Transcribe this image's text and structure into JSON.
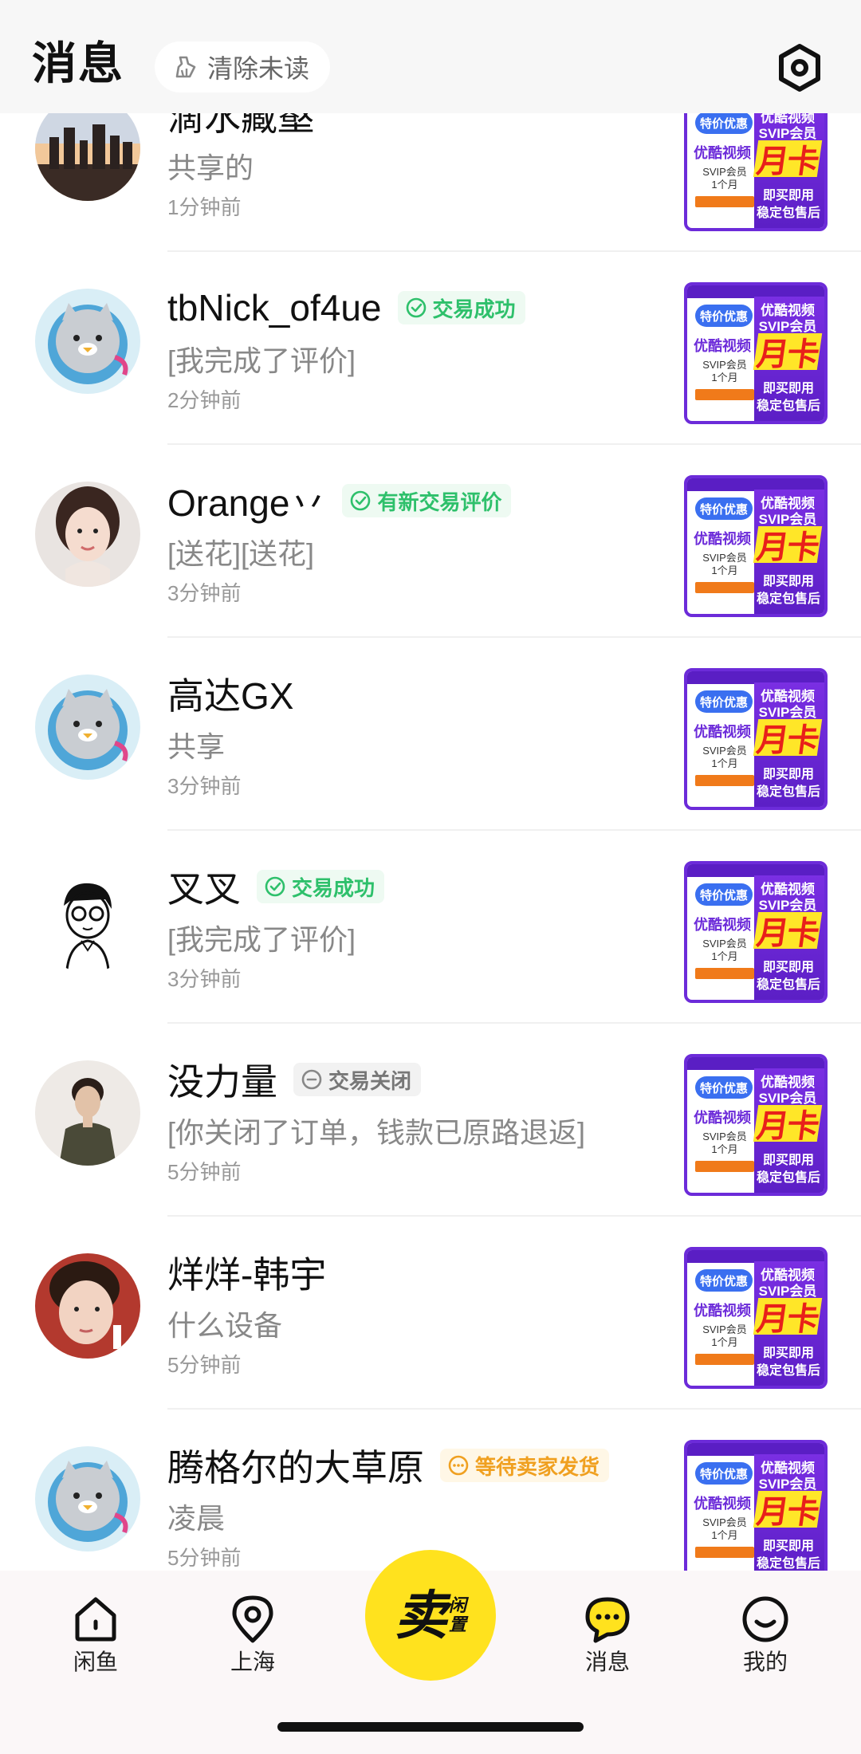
{
  "header": {
    "title": "消息",
    "clear_unread_label": "清除未读",
    "clear_icon": "broom-icon",
    "settings_icon": "settings-icon"
  },
  "thumbnail": {
    "pill": "特价优惠",
    "right_line1": "优酷视频",
    "right_line2": "SVIP会员",
    "left_brand": "优酷视频",
    "card": "月卡",
    "svip": "SVIP会员",
    "duration": "1个月",
    "buy": "即买即用",
    "stable": "稳定包售后"
  },
  "messages": [
    {
      "name": "滴水藏壑",
      "badge": "",
      "badge_type": "",
      "preview": "共享的",
      "time": "1分钟前",
      "avatar": "city-skyline-avatar"
    },
    {
      "name": "tbNick_of4ue",
      "badge": "交易成功",
      "badge_type": "green",
      "preview": "[我完成了评价]",
      "time": "2分钟前",
      "avatar": "cat-mascot-avatar"
    },
    {
      "name": "Orange丷",
      "badge": "有新交易评价",
      "badge_type": "green",
      "preview": "[送花][送花]",
      "time": "3分钟前",
      "avatar": "girl-portrait-avatar"
    },
    {
      "name": "高达GX",
      "badge": "",
      "badge_type": "",
      "preview": "共享",
      "time": "3分钟前",
      "avatar": "cat-mascot-avatar"
    },
    {
      "name": "叉叉",
      "badge": "交易成功",
      "badge_type": "green",
      "preview": "[我完成了评价]",
      "time": "3分钟前",
      "avatar": "cartoon-boy-avatar"
    },
    {
      "name": "没力量",
      "badge": "交易关闭",
      "badge_type": "gray",
      "preview": "[你关闭了订单，钱款已原路退返]",
      "time": "5分钟前",
      "avatar": "man-portrait-avatar"
    },
    {
      "name": "烊烊-韩宇",
      "badge": "",
      "badge_type": "",
      "preview": "什么设备",
      "time": "5分钟前",
      "avatar": "boy-portrait-avatar"
    },
    {
      "name": "腾格尔的大草原",
      "badge": "等待卖家发货",
      "badge_type": "orange",
      "preview": "凌晨",
      "time": "5分钟前",
      "avatar": "cat-mascot-avatar"
    }
  ],
  "tabbar": {
    "tabs": [
      {
        "label": "闲鱼",
        "icon": "home-icon"
      },
      {
        "label": "上海",
        "icon": "location-icon"
      },
      {
        "label": "消息",
        "icon": "message-icon"
      },
      {
        "label": "我的",
        "icon": "profile-icon"
      }
    ],
    "sell_big": "卖",
    "sell_small_1": "闲",
    "sell_small_2": "置"
  },
  "colors": {
    "accent_yellow": "#ffe21e",
    "success_green": "#2ec06b",
    "pending_orange": "#f0a020",
    "thumb_purple": "#6c2bd9"
  }
}
